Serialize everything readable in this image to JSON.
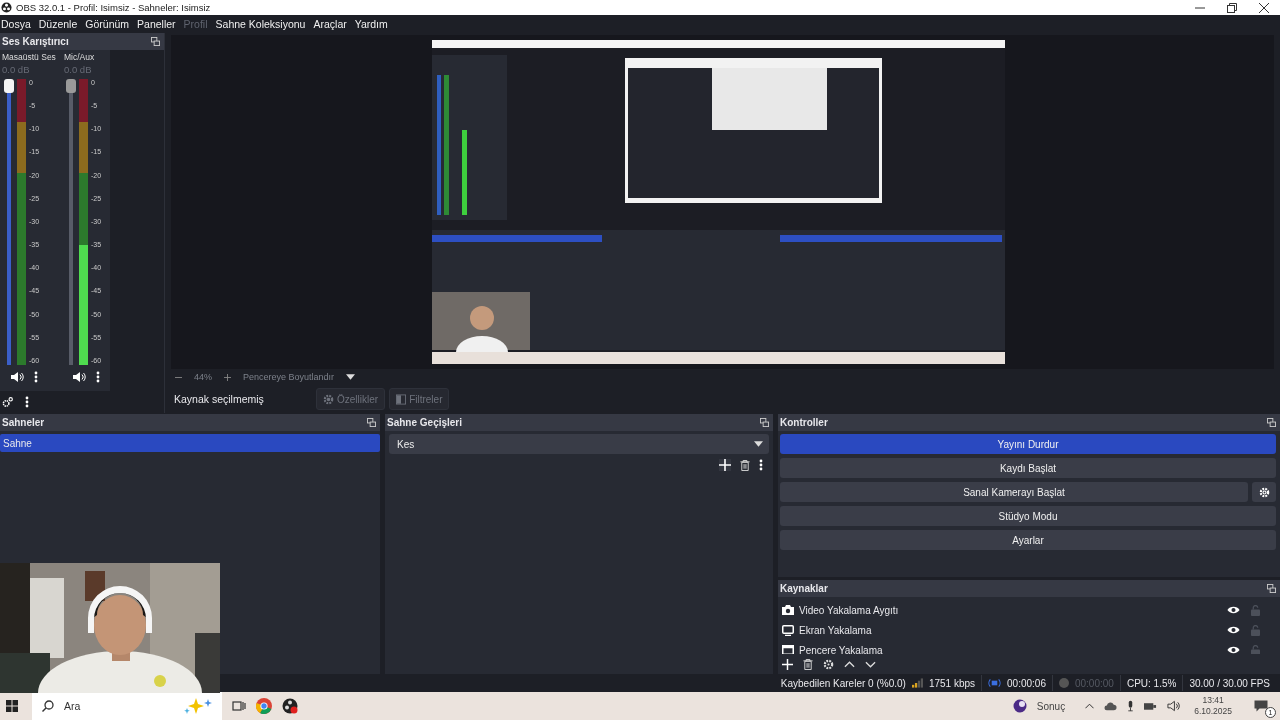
{
  "window": {
    "title": "OBS 32.0.1 - Profil: Isimsiz - Sahneler: Isimsiz"
  },
  "menu": [
    {
      "label": "Dosya",
      "disabled": false
    },
    {
      "label": "Düzenle",
      "disabled": false
    },
    {
      "label": "Görünüm",
      "disabled": false
    },
    {
      "label": "Paneller",
      "disabled": false
    },
    {
      "label": "Profil",
      "disabled": true
    },
    {
      "label": "Sahne Koleksiyonu",
      "disabled": false
    },
    {
      "label": "Araçlar",
      "disabled": false
    },
    {
      "label": "Yardım",
      "disabled": false
    }
  ],
  "mixer": {
    "title": "Ses Karıştırıcı",
    "channels": [
      {
        "name": "Masaüstü Ses",
        "reading": "0.0 dB",
        "active": true,
        "volume": {
          "level": 1
        },
        "meter": {
          "level": 0
        },
        "scale": [
          "0",
          "-5",
          "-10",
          "-15",
          "-20",
          "-25",
          "-30",
          "-35",
          "-40",
          "-45",
          "-50",
          "-55",
          "-60"
        ]
      },
      {
        "name": "Mic/Aux",
        "reading": "0.0 dB",
        "active": false,
        "volume": {
          "level": 1
        },
        "meter": {
          "level": 0.42
        },
        "scale": [
          "0",
          "-5",
          "-10",
          "-15",
          "-20",
          "-25",
          "-30",
          "-35",
          "-40",
          "-45",
          "-50",
          "-55",
          "-60"
        ]
      }
    ]
  },
  "preview": {
    "kind": "picture",
    "zoom": "44%",
    "fit": "Pencereye Boyutlandır"
  },
  "source_toolbar": {
    "status": "Kaynak seçilmemiş",
    "buttons": [
      {
        "label": "Özellikler",
        "kind": "properties",
        "disabled": true
      },
      {
        "label": "Filtreler",
        "kind": "filters",
        "disabled": true
      }
    ]
  },
  "scenes": {
    "title": "Sahneler",
    "items": [
      {
        "name": "Sahne",
        "selected": true
      }
    ]
  },
  "transitions": {
    "title": "Sahne Geçişleri",
    "value": "Kes"
  },
  "controls": {
    "title": "Kontroller",
    "buttons": [
      {
        "label": "Yayını Durdur",
        "active": true,
        "settings": false
      },
      {
        "label": "Kaydı Başlat",
        "active": false,
        "settings": false
      },
      {
        "label": "Sanal Kamerayı Başlat",
        "active": false,
        "settings": true
      },
      {
        "label": "Stüdyo Modu",
        "active": false,
        "settings": false
      },
      {
        "label": "Ayarlar",
        "active": false,
        "settings": false
      }
    ]
  },
  "sources": {
    "title": "Kaynaklar",
    "items": [
      {
        "name": "Video Yakalama Aygıtı",
        "kind": "camera",
        "visible": true,
        "locked": false
      },
      {
        "name": "Ekran Yakalama",
        "kind": "display",
        "visible": true,
        "locked": false
      },
      {
        "name": "Pencere Yakalama",
        "kind": "window",
        "visible": true,
        "locked": false
      }
    ]
  },
  "status_bar": {
    "dropped": "Kaybedilen Kareler 0 (%0.0)",
    "bitrate": "1751 kbps",
    "streaming": true,
    "stream_time": "00:00:06",
    "recording": false,
    "record_time": "00:00:00",
    "cpu": "CPU: 1.5%",
    "fps": "30.00 / 30.00 FPS"
  },
  "taskbar": {
    "search": {
      "placeholder": "Ara"
    },
    "weather": "Sonuç",
    "time": "13:41",
    "date": "6.10.2025",
    "notifications": "1"
  }
}
